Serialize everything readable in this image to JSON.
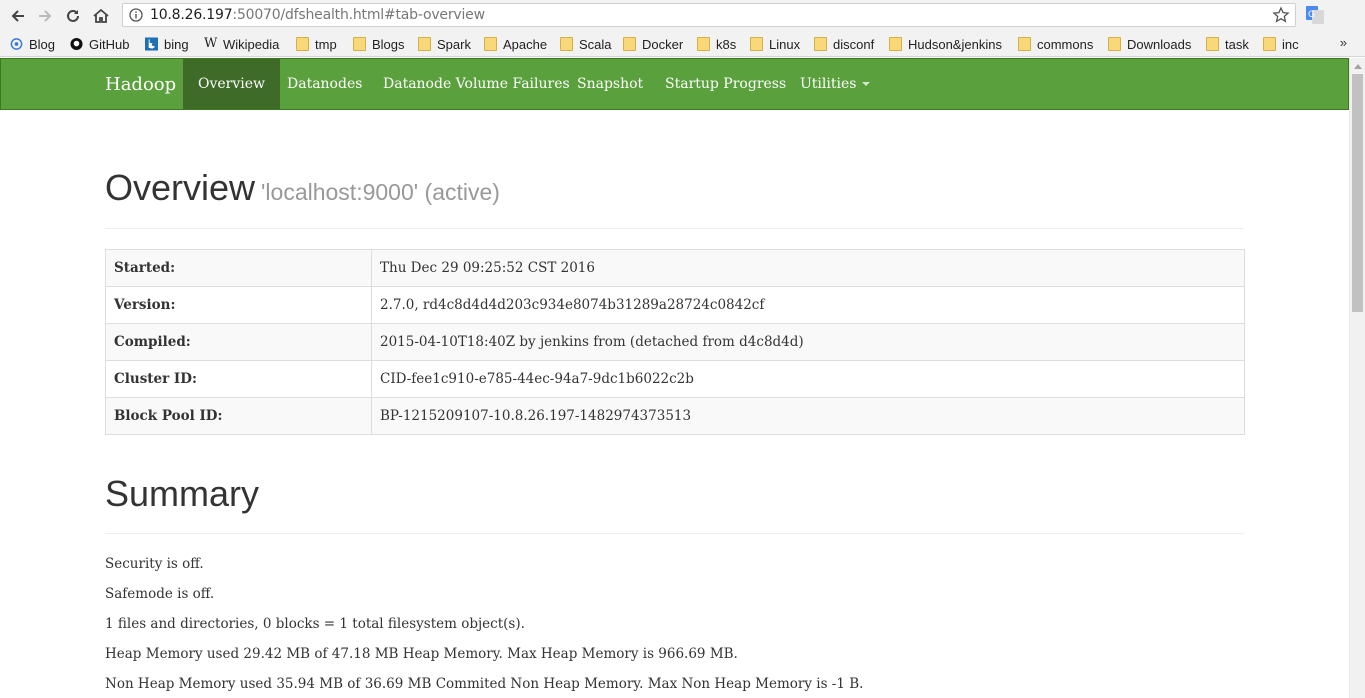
{
  "browser": {
    "url_host": "10.8.26.197",
    "url_path": ":50070/dfshealth.html#tab-overview",
    "bookmarks": [
      "Blog",
      "GitHub",
      "bing",
      "Wikipedia",
      "tmp",
      "Blogs",
      "Spark",
      "Apache",
      "Scala",
      "Docker",
      "k8s",
      "Linux",
      "disconf",
      "Hudson&jenkins",
      "commons",
      "Downloads",
      "task",
      "inc"
    ],
    "more": "»"
  },
  "nav": {
    "brand": "Hadoop",
    "items": [
      "Overview",
      "Datanodes",
      "Datanode Volume Failures",
      "Snapshot",
      "Startup Progress",
      "Utilities"
    ],
    "active": "Overview"
  },
  "overview": {
    "title": "Overview",
    "subtitle": "'localhost:9000' (active)",
    "rows": [
      {
        "k": "Started:",
        "v": "Thu Dec 29 09:25:52 CST 2016"
      },
      {
        "k": "Version:",
        "v": "2.7.0, rd4c8d4d4d203c934e8074b31289a28724c0842cf"
      },
      {
        "k": "Compiled:",
        "v": "2015-04-10T18:40Z by jenkins from (detached from d4c8d4d)"
      },
      {
        "k": "Cluster ID:",
        "v": "CID-fee1c910-e785-44ec-94a7-9dc1b6022c2b"
      },
      {
        "k": "Block Pool ID:",
        "v": "BP-1215209107-10.8.26.197-1482974373513"
      }
    ]
  },
  "summary": {
    "title": "Summary",
    "lines": [
      "Security is off.",
      "Safemode is off.",
      "1 files and directories, 0 blocks = 1 total filesystem object(s).",
      "Heap Memory used 29.42 MB of 47.18 MB Heap Memory. Max Heap Memory is 966.69 MB.",
      "Non Heap Memory used 35.94 MB of 36.69 MB Commited Non Heap Memory. Max Non Heap Memory is -1 B."
    ]
  },
  "colors": {
    "navbar": "#5aa03c",
    "navbar_active": "#3e6b27"
  }
}
